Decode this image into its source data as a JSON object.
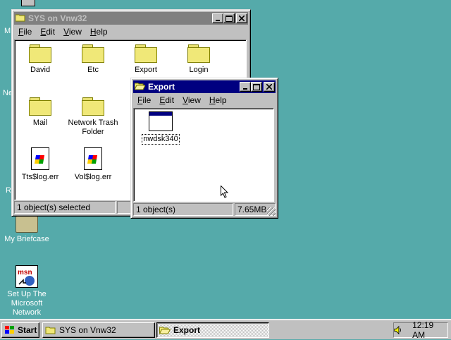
{
  "desktop": {
    "icons": [
      {
        "label": "My Briefcase"
      },
      {
        "label": "Set Up The Microsoft Network"
      }
    ],
    "clipped_labels": [
      "M",
      "Ne",
      "R"
    ],
    "background": "#55aaaa"
  },
  "window_sys": {
    "title": "SYS on Vnw32",
    "menu": [
      "File",
      "Edit",
      "View",
      "Help"
    ],
    "items": [
      {
        "label": "David",
        "icon": "folder-icon"
      },
      {
        "label": "Etc",
        "icon": "folder-icon"
      },
      {
        "label": "Export",
        "icon": "folder-icon"
      },
      {
        "label": "Login",
        "icon": "folder-icon"
      },
      {
        "label": "Mail",
        "icon": "folder-icon"
      },
      {
        "label": "Network Trash Folder",
        "icon": "folder-icon"
      },
      {
        "label": "Tts$log.err",
        "icon": "log-file-icon"
      },
      {
        "label": "Vol$log.err",
        "icon": "log-file-icon"
      }
    ],
    "status": "1 object(s) selected"
  },
  "window_export": {
    "title": "Export",
    "menu": [
      "File",
      "Edit",
      "View",
      "Help"
    ],
    "items": [
      {
        "label": "nwdsk340",
        "icon": "program-icon"
      }
    ],
    "status_left": "1 object(s)",
    "status_right": "7.65MB"
  },
  "taskbar": {
    "start_label": "Start",
    "buttons": [
      {
        "label": "SYS on Vnw32"
      },
      {
        "label": "Export"
      }
    ],
    "clock": "12:19 AM",
    "tray_icon": "speaker-icon"
  },
  "colors": {
    "active_title": "#000080",
    "inactive_title": "#808080",
    "face": "#c0c0c0"
  }
}
